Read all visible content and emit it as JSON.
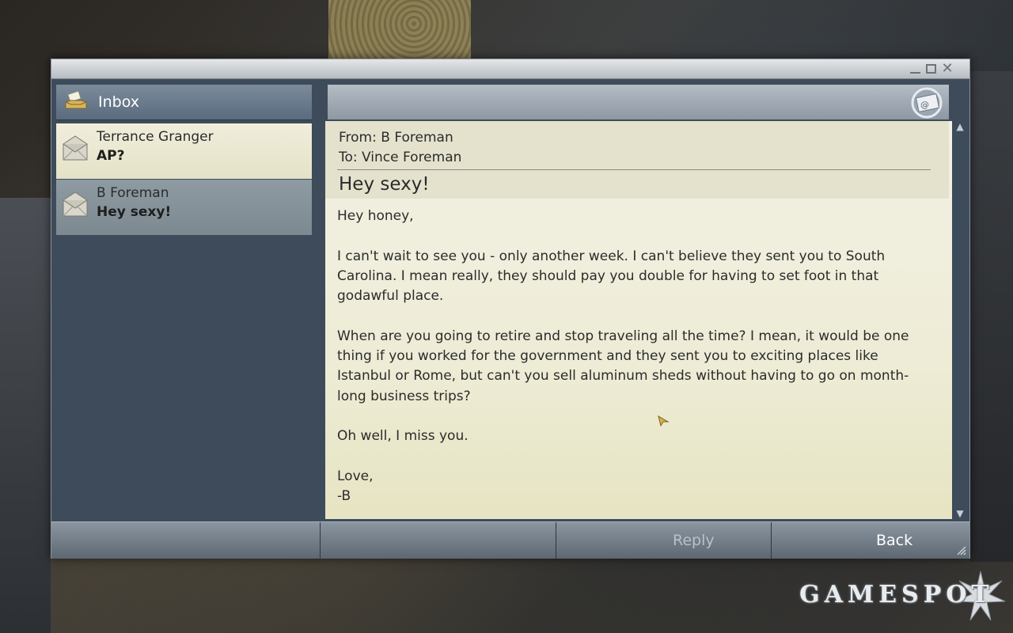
{
  "inbox": {
    "title": "Inbox",
    "items": [
      {
        "sender": "Terrance Granger",
        "subject": "AP?"
      },
      {
        "sender": "B Foreman",
        "subject": "Hey sexy!"
      }
    ]
  },
  "message": {
    "from": "From: B Foreman",
    "to": "To: Vince Foreman",
    "subject": "Hey sexy!",
    "body": [
      "Hey honey,",
      "I can't wait to see you - only another week. I can't believe they sent you to South Carolina. I mean really, they should pay you double for having to set foot in that godawful place.",
      "When are you going to retire and stop traveling all the time? I mean, it would be one thing if you worked for the government and they sent you to exciting places like Istanbul or Rome, but can't you sell aluminum sheds without having to go on month-long business trips?",
      "Oh well, I miss you.",
      "Love,",
      "-B"
    ]
  },
  "toolbar": {
    "reply_label": "Reply",
    "back_label": "Back"
  },
  "watermark": "GAMESPOT",
  "colors": {
    "selected_item": "#e9e7cf",
    "unselected_item": "#87939a",
    "window_panel": "#3d4b5b",
    "reply_disabled": "#b9c0c6"
  }
}
